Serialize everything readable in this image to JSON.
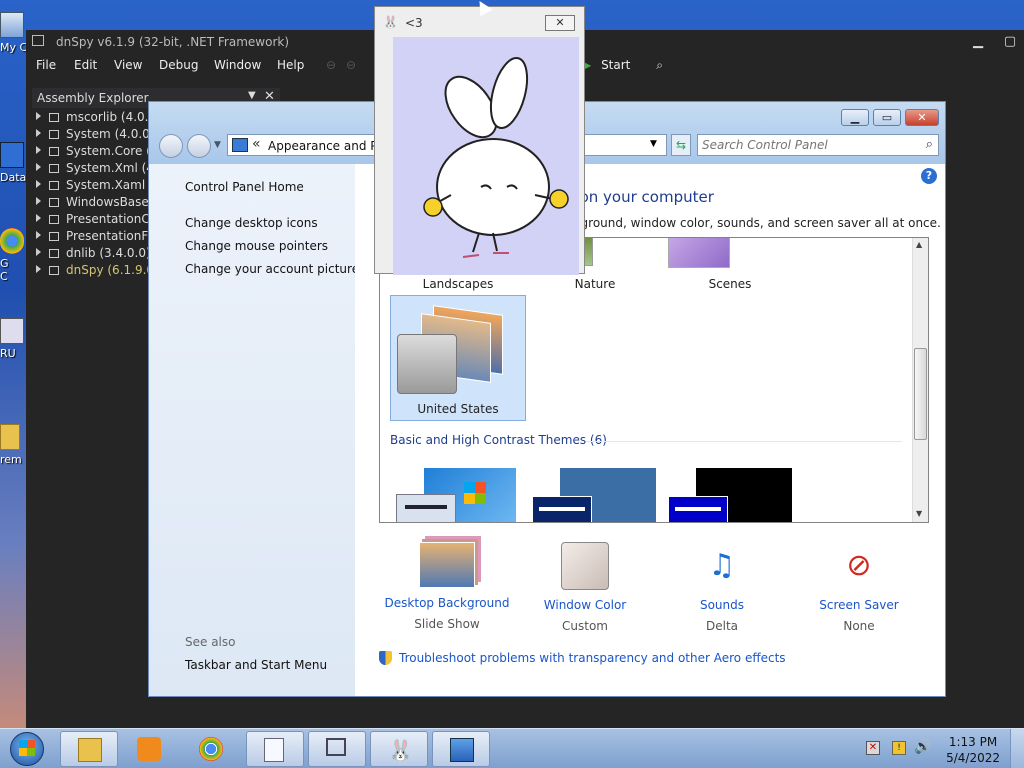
{
  "desktop": {
    "icons": [
      {
        "label": "My C",
        "icon": "computer-icon"
      },
      {
        "label": "Data",
        "icon": "data-icon"
      },
      {
        "label": "G\nC",
        "icon": "chrome-shortcut-icon"
      },
      {
        "label": "RU",
        "icon": "app-icon"
      },
      {
        "label": "rem",
        "icon": "folder-icon"
      }
    ]
  },
  "dnspy": {
    "title": "dnSpy v6.1.9 (32-bit, .NET Framework)",
    "menu": [
      "File",
      "Edit",
      "View",
      "Debug",
      "Window",
      "Help"
    ],
    "start_label": "Start",
    "assembly_explorer": {
      "title": "Assembly Explorer",
      "items": [
        "mscorlib (4.0.0.0)",
        "System (4.0.0.0)",
        "System.Core (4.0.0.0)",
        "System.Xml (4.0.0.0)",
        "System.Xaml (4.0.0.0)",
        "WindowsBase (4.0.0.0)",
        "PresentationCore (4.0.0.0)",
        "PresentationFramework (4.0.0.0)",
        "dnlib (3.4.0.0)",
        "dnSpy (6.1.9.0)"
      ]
    }
  },
  "control_panel": {
    "breadcrumb_prefix": "«",
    "breadcrumb": "Appearance and Perso",
    "search_placeholder": "Search Control Panel",
    "left_links": [
      "Control Panel Home",
      "Change desktop icons",
      "Change mouse pointers",
      "Change your account picture"
    ],
    "see_also": "See also",
    "see_also_links": [
      "Taskbar and Start Menu"
    ],
    "heading": "s on your computer",
    "subheading": "ckground, window color, sounds, and screen saver all at once.",
    "theme_labels": [
      "Landscapes",
      "Nature",
      "Scenes",
      "United States"
    ],
    "basic_section": "Basic and High Contrast Themes (6)",
    "bottom": [
      {
        "label": "Desktop Background",
        "value": "Slide Show",
        "icon": "desktop-background-icon"
      },
      {
        "label": "Window Color",
        "value": "Custom",
        "icon": "window-color-icon"
      },
      {
        "label": "Sounds",
        "value": "Delta",
        "icon": "sounds-icon"
      },
      {
        "label": "Screen Saver",
        "value": "None",
        "icon": "screen-saver-icon"
      }
    ],
    "troubleshoot": "Troubleshoot problems with transparency and other Aero effects"
  },
  "bunny_window": {
    "title": "<3"
  },
  "taskbar": {
    "buttons": [
      "explorer-icon",
      "media-player-icon",
      "chrome-icon",
      "notepad-icon",
      "task-view-icon",
      "bunny-app-icon",
      "control-panel-icon"
    ],
    "time": "1:13 PM",
    "date": "5/4/2022"
  },
  "colors": {
    "link": "#1a55c9",
    "heading": "#1e3d8e",
    "dnspy_bg": "#252526",
    "bunny_bg": "#d2d1f6"
  }
}
